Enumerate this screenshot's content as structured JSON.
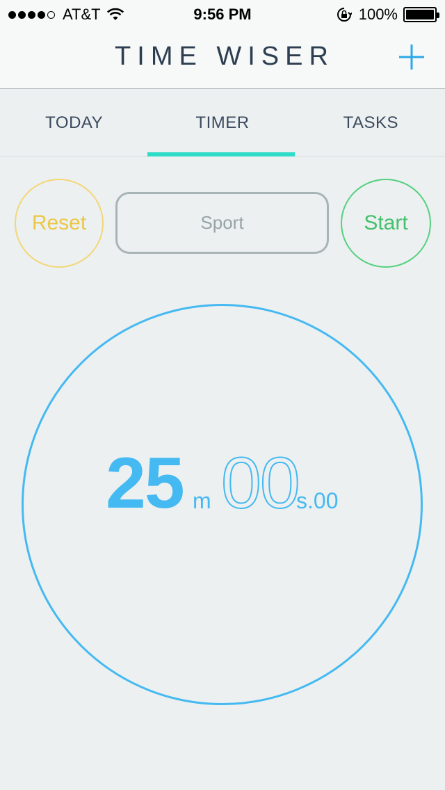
{
  "status_bar": {
    "carrier": "AT&T",
    "time": "9:56 PM",
    "battery": "100%",
    "signal_bars": 4,
    "signal_total": 5,
    "icons": [
      "wifi-icon",
      "rotation-lock-icon",
      "battery-icon"
    ]
  },
  "header": {
    "title": "TIME WISER",
    "add_icon": "plus-icon",
    "accent": "#2aa9e8"
  },
  "tabs": [
    {
      "label": "TODAY"
    },
    {
      "label": "TIMER",
      "active": true
    },
    {
      "label": "TASKS"
    }
  ],
  "controls": {
    "reset_label": "Reset",
    "task_label": "Sport",
    "start_label": "Start",
    "reset_color": "#ebc746",
    "start_color": "#45c06d"
  },
  "timer": {
    "minutes": "25",
    "minutes_unit": "m",
    "seconds": "00",
    "seconds_unit": "s.00",
    "ring_color": "#45b9f1"
  }
}
